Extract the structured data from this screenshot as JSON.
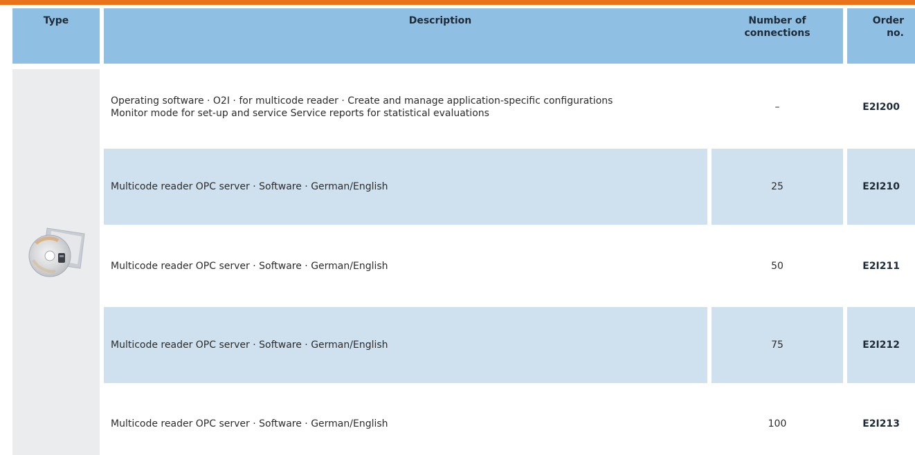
{
  "header": {
    "type": "Type",
    "description": "Description",
    "connections_line1": "Number of",
    "connections_line2": "connections",
    "order_line1": "Order",
    "order_line2": "no."
  },
  "rows": [
    {
      "description_line1": "Operating software · O2I · for multicode reader · Create and manage application-specific configurations",
      "description_line2": "Monitor mode for set-up and service  Service reports for statistical evaluations",
      "connections": "–",
      "order_no": "E2I200"
    },
    {
      "description_line1": "Multicode reader OPC server · Software · German/English",
      "connections": "25",
      "order_no": "E2I210"
    },
    {
      "description_line1": "Multicode reader OPC server · Software · German/English",
      "connections": "50",
      "order_no": "E2I211"
    },
    {
      "description_line1": "Multicode reader OPC server · Software · German/English",
      "connections": "75",
      "order_no": "E2I212"
    },
    {
      "description_line1": "Multicode reader OPC server · Software · German/English",
      "connections": "100",
      "order_no": "E2I213"
    }
  ],
  "colors": {
    "accent_bar": "#e8731a",
    "header_bg": "#8fc0e3",
    "shaded_row": "#cfe1ef",
    "type_column_bg": "#eaecee"
  },
  "icons": {
    "product_image": "software-cd-icon"
  }
}
